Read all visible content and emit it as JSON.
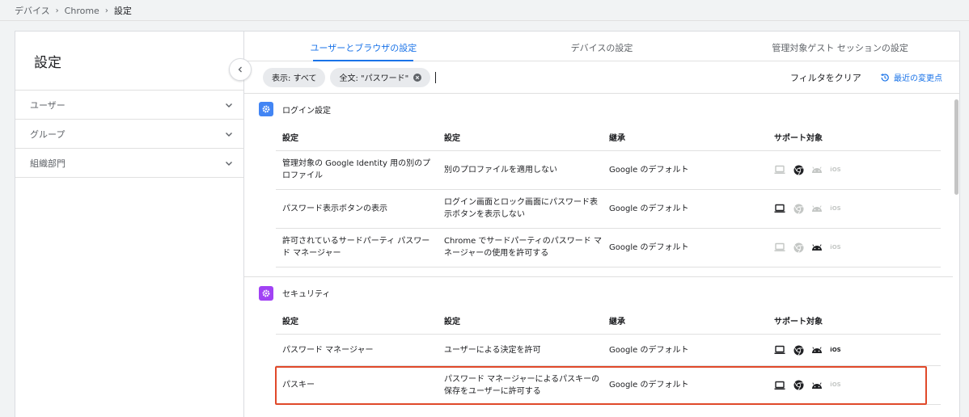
{
  "breadcrumb": {
    "items": [
      "デバイス",
      "Chrome"
    ],
    "current": "設定"
  },
  "sidebar": {
    "title": "設定",
    "items": [
      {
        "label": "ユーザー"
      },
      {
        "label": "グループ"
      },
      {
        "label": "組織部門"
      }
    ]
  },
  "tabs": [
    {
      "label": "ユーザーとブラウザの設定",
      "active": true
    },
    {
      "label": "デバイスの設定",
      "active": false
    },
    {
      "label": "管理対象ゲスト セッションの設定",
      "active": false
    }
  ],
  "filters": {
    "chips": [
      {
        "label": "表示: すべて",
        "removable": false
      },
      {
        "label": "全文: \"パスワード\"",
        "removable": true
      }
    ],
    "clear_label": "フィルタをクリア",
    "recent_label": "最近の変更点"
  },
  "colors": {
    "accent": "#1a73e8",
    "login_icon": "#4285f4",
    "security_icon": "#a142f4",
    "highlight": "#e0492a",
    "supported": "#202124",
    "unsupported": "#c4c7c5"
  },
  "sections": [
    {
      "title": "ログイン設定",
      "icon": "gear-icon",
      "headers": [
        "設定",
        "設定",
        "継承",
        "サポート対象"
      ],
      "rows": [
        {
          "name": "管理対象の Google Identity 用の別のプロファイル",
          "setting": "別のプロファイルを適用しない",
          "inherit": "Google のデフォルト",
          "support": {
            "laptop": false,
            "chrome": true,
            "android": false,
            "ios": false
          }
        },
        {
          "name": "パスワード表示ボタンの表示",
          "setting": "ログイン画面とロック画面にパスワード表示ボタンを表示しない",
          "inherit": "Google のデフォルト",
          "support": {
            "laptop": true,
            "chrome": false,
            "android": false,
            "ios": false
          }
        },
        {
          "name": "許可されているサードパーティ パスワード マネージャー",
          "setting": "Chrome でサードパーティのパスワード マネージャーの使用を許可する",
          "inherit": "Google のデフォルト",
          "support": {
            "laptop": false,
            "chrome": false,
            "android": true,
            "ios": false
          }
        }
      ]
    },
    {
      "title": "セキュリティ",
      "icon": "gear-icon",
      "headers": [
        "設定",
        "設定",
        "継承",
        "サポート対象"
      ],
      "rows": [
        {
          "name": "パスワード マネージャー",
          "setting": "ユーザーによる決定を許可",
          "inherit": "Google のデフォルト",
          "support": {
            "laptop": true,
            "chrome": true,
            "android": true,
            "ios": true
          }
        },
        {
          "name": "パスキー",
          "setting": "パスワード マネージャーによるパスキーの保存をユーザーに許可する",
          "inherit": "Google のデフォルト",
          "support": {
            "laptop": true,
            "chrome": true,
            "android": true,
            "ios": false
          }
        }
      ]
    }
  ]
}
